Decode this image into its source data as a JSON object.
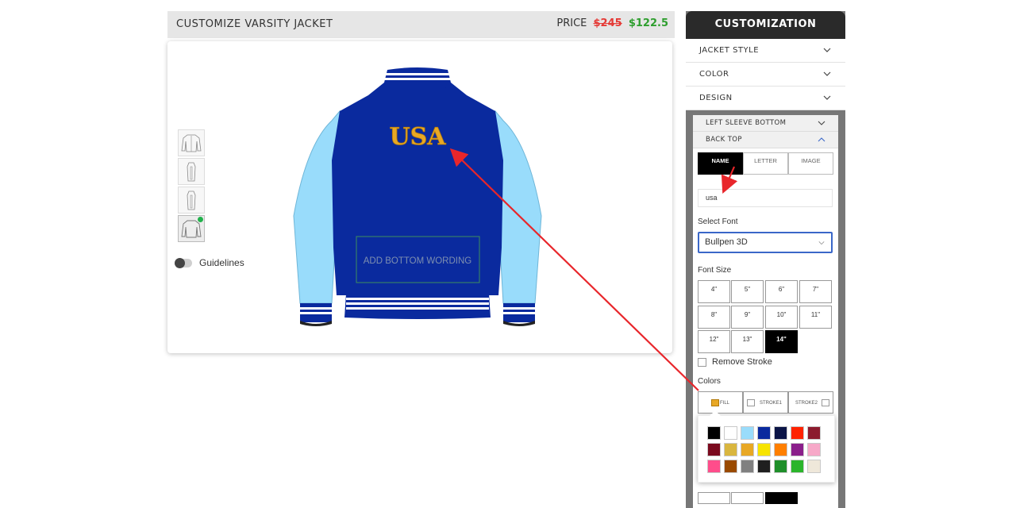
{
  "header": {
    "title": "CUSTOMIZE VARSITY JACKET",
    "price_label": "PRICE",
    "old_price": "$245",
    "new_price": "$122.5"
  },
  "canvas": {
    "back_text": "USA",
    "bottom_wording_placeholder": "ADD BOTTOM WORDING",
    "guidelines_label": "Guidelines",
    "colors": {
      "body": "#0a2a9e",
      "sleeves": "#99dcfb",
      "back_text": "#e8a825",
      "rib_white": "#ffffff"
    }
  },
  "panel": {
    "title": "CUSTOMIZATION",
    "accordion": [
      {
        "label": "JACKET STYLE"
      },
      {
        "label": "COLOR"
      },
      {
        "label": "DESIGN"
      }
    ],
    "sub_sections": [
      {
        "label": "LEFT SLEEVE BOTTOM"
      },
      {
        "label": "BACK TOP"
      }
    ],
    "type_tabs": [
      "NAME",
      "LETTER",
      "IMAGE"
    ],
    "name_value": "usa",
    "select_font_label": "Select Font",
    "font_value": "Bullpen 3D",
    "font_size_label": "Font Size",
    "font_sizes": [
      "4\"",
      "5\"",
      "6\"",
      "7\"",
      "8\"",
      "9\"",
      "10\"",
      "11\"",
      "12\"",
      "13\"",
      "14\""
    ],
    "remove_stroke_label": "Remove Stroke",
    "colors_label": "Colors",
    "color_tabs": [
      "FILL",
      "STROKE1",
      "STROKE2"
    ],
    "fill_color": "#e8a825",
    "palette": [
      "#000000",
      "#ffffff",
      "#99dcfb",
      "#0a2a9e",
      "#0b1446",
      "#ff2200",
      "#8c1b2e",
      "#7a0a1e",
      "#d9b63f",
      "#e8a825",
      "#f7e400",
      "#ff7f00",
      "#8a1e8a",
      "#f7a8c8",
      "#ff4d8b",
      "#9a4a00",
      "#808080",
      "#1f1f1f",
      "#1f8f2a",
      "#2bb52b",
      "#efe8da"
    ]
  }
}
